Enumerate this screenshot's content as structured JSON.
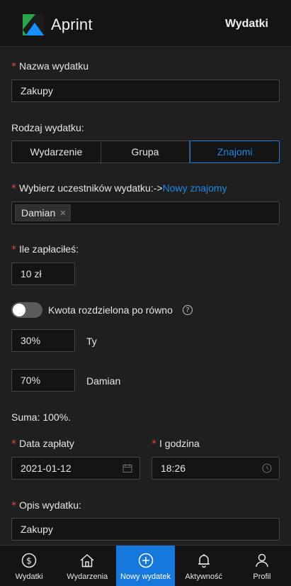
{
  "header": {
    "app_name": "Aprint",
    "page_title": "Wydatki"
  },
  "form": {
    "name": {
      "label": "Nazwa wydatku",
      "value": "Zakupy"
    },
    "type": {
      "label": "Rodzaj wydatku:",
      "options": [
        "Wydarzenie",
        "Grupa",
        "Znajomi"
      ],
      "selected": "Znajomi"
    },
    "participants": {
      "label": "Wybierz uczestników wydatku:->",
      "link": "Nowy znajomy",
      "tags": [
        "Damian"
      ]
    },
    "paid": {
      "label": "Ile zapłaciłeś:",
      "value": "10 zł"
    },
    "split": {
      "label": "Kwota rozdzielona po równo",
      "enabled": false,
      "help": "?"
    },
    "shares": [
      {
        "value": "30%",
        "name": "Ty"
      },
      {
        "value": "70%",
        "name": "Damian"
      }
    ],
    "sum": "Suma: 100%.",
    "date": {
      "label": "Data zapłaty",
      "value": "2021-01-12"
    },
    "time": {
      "label": "I godzina",
      "value": "18:26"
    },
    "description": {
      "label": "Opis wydatku:",
      "value": "Zakupy"
    },
    "required_mark": "*"
  },
  "tabbar": {
    "items": [
      {
        "label": "Wydatki",
        "icon": "dollar-icon"
      },
      {
        "label": "Wydarzenia",
        "icon": "home-icon"
      },
      {
        "label": "Nowy wydatek",
        "icon": "plus-circle-icon"
      },
      {
        "label": "Aktywność",
        "icon": "bell-icon"
      },
      {
        "label": "Profil",
        "icon": "user-icon"
      }
    ],
    "active_index": 2
  },
  "colors": {
    "accent": "#177ddc",
    "required": "#d84a4a",
    "background": "#1f1f1f",
    "input_bg": "#141414"
  }
}
